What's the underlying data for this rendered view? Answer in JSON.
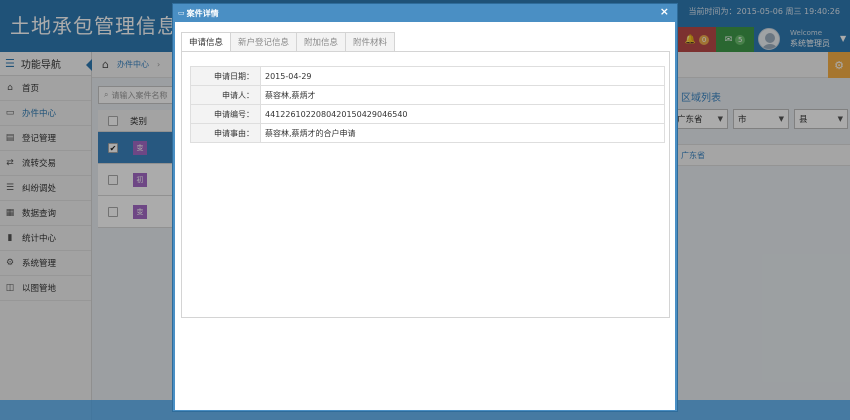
{
  "header": {
    "app_title": "土地承包管理信息系统",
    "time_text": "当前时间为：2015-05-06 周三 19:40:26",
    "notifications": {
      "count": "0",
      "color": "#b94a48",
      "icon": "bell-icon"
    },
    "messages": {
      "count": "5",
      "color": "#3f9a4a",
      "icon": "envelope-icon"
    },
    "welcome": "Welcome",
    "username": "系统管理员"
  },
  "sidebar": {
    "title": "功能导航",
    "items": [
      {
        "label": "首页",
        "icon": "home-icon"
      },
      {
        "label": "办件中心",
        "icon": "desktop-icon"
      },
      {
        "label": "登记管理",
        "icon": "book-icon"
      },
      {
        "label": "流转交易",
        "icon": "exchange-icon"
      },
      {
        "label": "纠纷调处",
        "icon": "list-icon"
      },
      {
        "label": "数据查询",
        "icon": "table-icon"
      },
      {
        "label": "统计中心",
        "icon": "chart-icon"
      },
      {
        "label": "系统管理",
        "icon": "gear-icon"
      },
      {
        "label": "以图管地",
        "icon": "map-icon"
      }
    ]
  },
  "main": {
    "breadcrumb": "办件中心",
    "search_placeholder": "请输入案件名称",
    "table": {
      "header": "类别",
      "rows": [
        {
          "tag": "变",
          "selected": true
        },
        {
          "tag": "初",
          "selected": false
        },
        {
          "tag": "变",
          "selected": false
        }
      ]
    },
    "region": {
      "title": "区域列表",
      "province": "广东省",
      "city": "市",
      "county": "县",
      "crumb": "广东省"
    }
  },
  "modal": {
    "title": "案件详情",
    "close": "×",
    "tabs": [
      "申请信息",
      "新户登记信息",
      "附加信息",
      "附件材料"
    ],
    "active_tab": 0,
    "fields": [
      {
        "label": "申请日期：",
        "value": "2015-04-29"
      },
      {
        "label": "申请人：",
        "value": "蔡容林,蔡炳才"
      },
      {
        "label": "申请编号：",
        "value": "441226102208042015042904654​0"
      },
      {
        "label": "申请事由：",
        "value": "蔡容林,蔡炳才的合户申请"
      }
    ]
  }
}
